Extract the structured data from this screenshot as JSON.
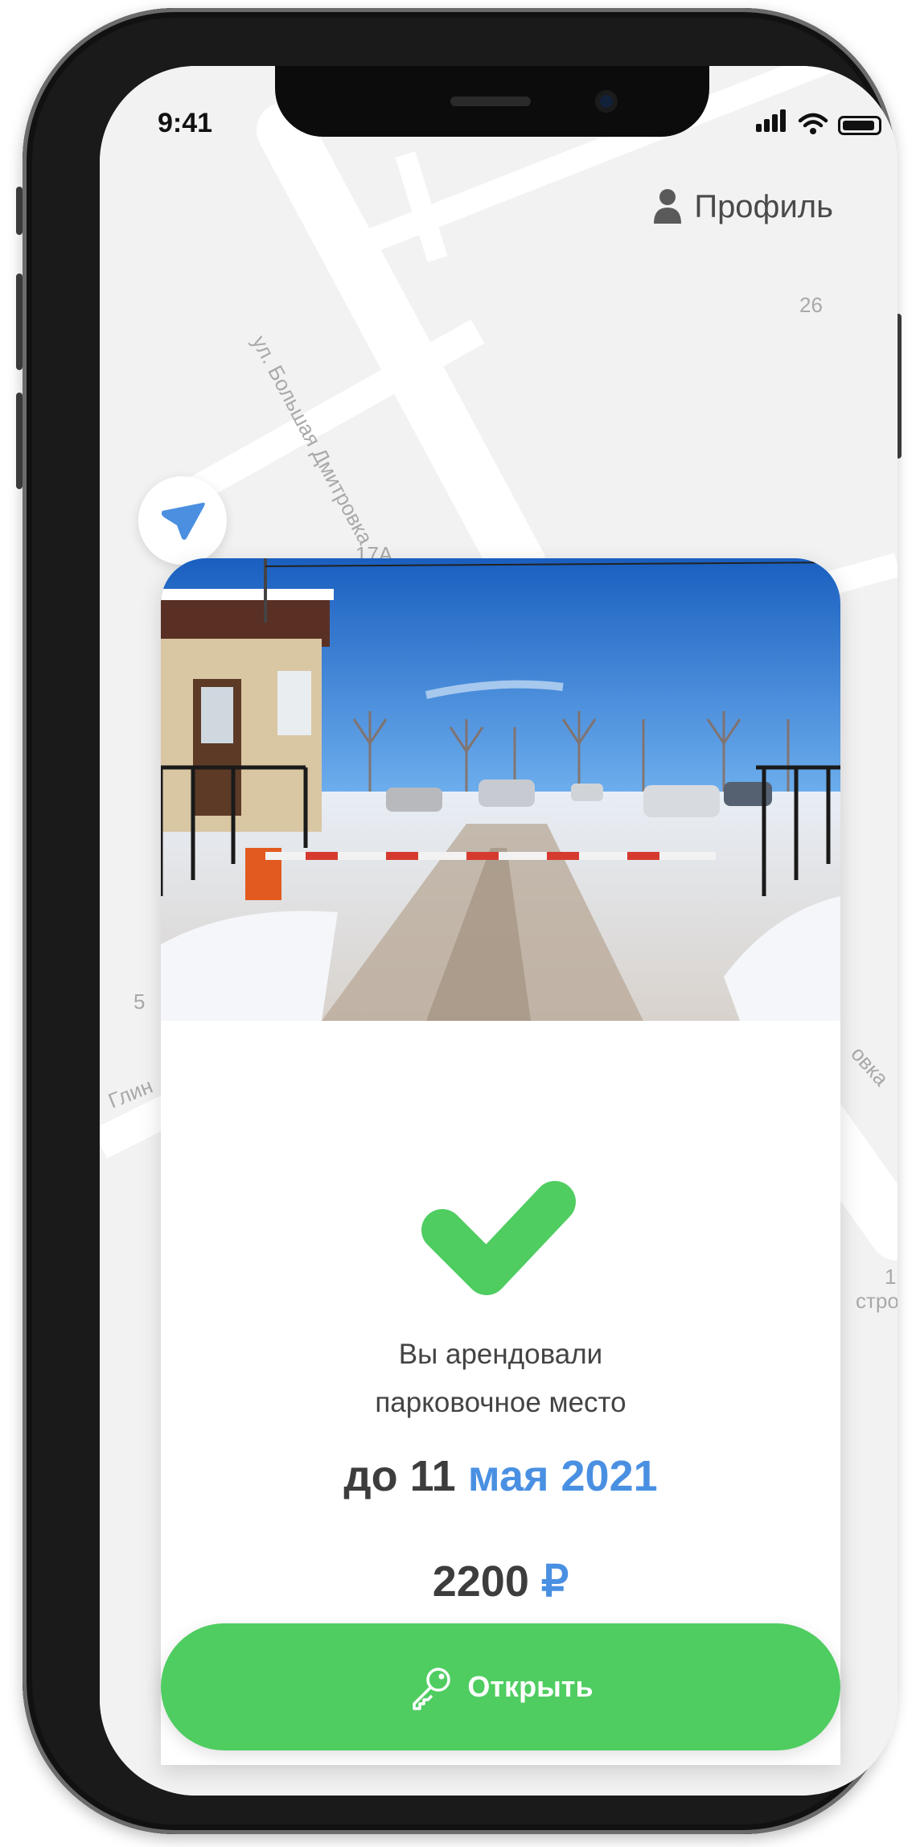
{
  "status_bar": {
    "time": "9:41"
  },
  "header": {
    "profile_label": "Профиль"
  },
  "map": {
    "street_1": "ул. Большая Дмитровка",
    "house_26": "26",
    "house_17a": "17А",
    "label_5": "5",
    "label_glin": "Глин",
    "label_ovka": "овка",
    "label_1": "1",
    "label_stro": "стро"
  },
  "booking": {
    "message_line1": "Вы арендовали",
    "message_line2": "парковочное место",
    "date_prefix": "до",
    "date_day": "11",
    "date_month": "мая",
    "date_year": "2021",
    "price_amount": "2200",
    "currency": "₽"
  },
  "actions": {
    "open_label": "Открыть"
  },
  "colors": {
    "accent_green": "#4fcd61",
    "accent_blue": "#4a90e2"
  }
}
